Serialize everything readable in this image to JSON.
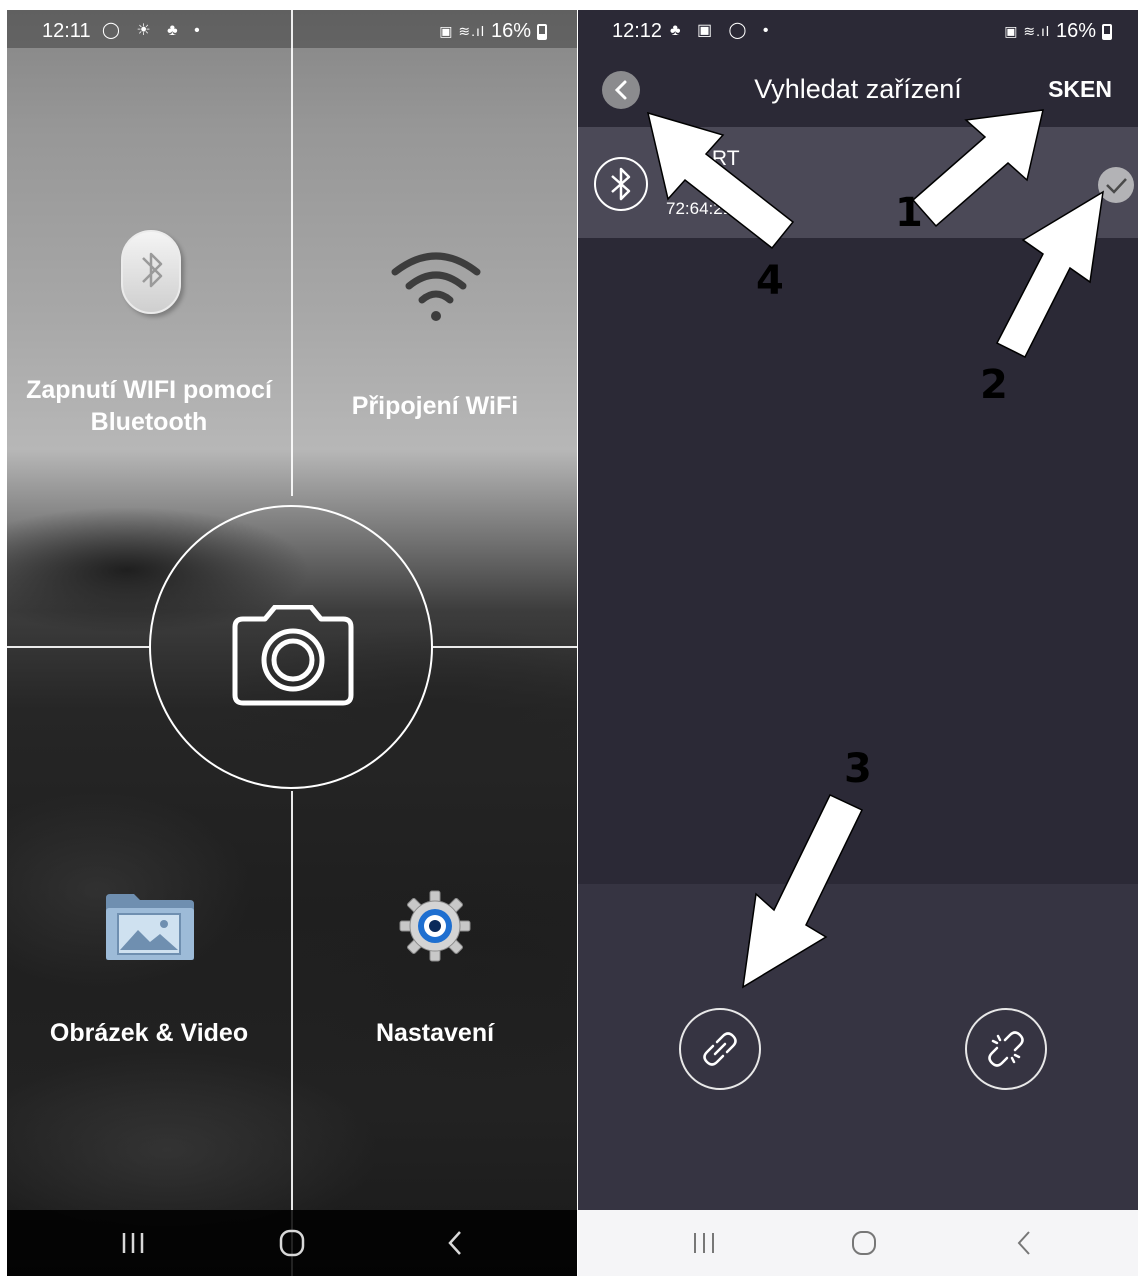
{
  "left_phone": {
    "status_bar": {
      "time": "12:11",
      "battery": "16%"
    },
    "tiles": {
      "bluetooth_wifi": {
        "label": "Zapnutí WIFI pomocí Bluetooth",
        "icon": "bluetooth-icon"
      },
      "wifi_connect": {
        "label": "Připojení WiFi",
        "icon": "wifi-icon"
      },
      "media": {
        "label": "Obrázek & Video",
        "icon": "gallery-folder-icon"
      },
      "settings": {
        "label": "Nastavení",
        "icon": "gear-icon"
      }
    },
    "center_button": {
      "icon": "camera-icon"
    },
    "nav_bar": [
      "recent-apps-icon",
      "home-icon",
      "back-icon"
    ]
  },
  "right_phone": {
    "status_bar": {
      "time": "12:12",
      "battery": "16%"
    },
    "title": "Vyhledat zařízení",
    "scan_label": "SKEN",
    "device": {
      "name": "RT ART",
      "mac": "72:64:21:  :57",
      "selected": true
    },
    "actions": [
      "link-icon",
      "unlink-icon"
    ],
    "nav_bar": [
      "recent-apps-icon",
      "home-icon",
      "back-icon"
    ]
  },
  "annotations": {
    "labels": [
      "1",
      "2",
      "3",
      "4"
    ],
    "arrow_color": "#ffffff",
    "label_color": "#000000"
  },
  "colors": {
    "right_background": "#2b2936",
    "device_row": "#4b4957",
    "action_panel": "#363442"
  }
}
